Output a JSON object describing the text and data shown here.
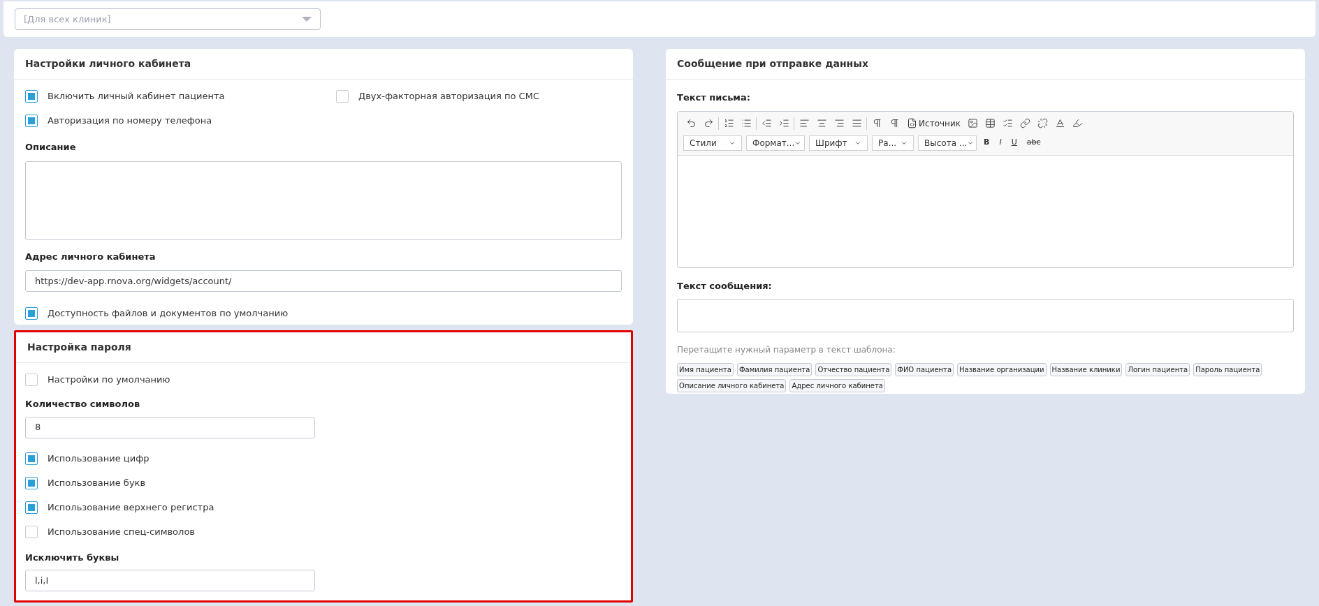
{
  "clinic_select": {
    "placeholder": "[Для всех клиник]"
  },
  "account_settings": {
    "title": "Настройки личного кабинета",
    "options": [
      {
        "label": "Включить личный кабинет пациента",
        "checked": true
      },
      {
        "label": "Двух-факторная авторизация по СМС",
        "checked": false
      },
      {
        "label": "Авторизация по номеру телефона",
        "checked": true
      }
    ],
    "description": {
      "label": "Описание"
    },
    "address": {
      "label": "Адрес личного кабинета",
      "value": "https://dev-app.rnova.org/widgets/account/"
    },
    "files_option": {
      "label": "Доступность файлов и документов по умолчанию",
      "checked": true
    }
  },
  "password_settings": {
    "title": "Настройка пароля",
    "highlighted": true,
    "default_option": {
      "label": "Настройки по умолчанию",
      "checked": false
    },
    "length": {
      "label": "Количество символов",
      "value": "8"
    },
    "options": [
      {
        "label": "Использование цифр",
        "checked": true
      },
      {
        "label": "Использование букв",
        "checked": true
      },
      {
        "label": "Использование верхнего регистра",
        "checked": true
      },
      {
        "label": "Использование спец-символов",
        "checked": false
      }
    ],
    "exclude": {
      "label": "Исключить буквы",
      "value": "l,i,I"
    }
  },
  "message_settings": {
    "title": "Сообщение при отправке данных",
    "letter_label": "Текст письма:",
    "editor": {
      "source_button": "Источник",
      "dropdowns": [
        "Стили",
        "Формат...",
        "Шрифт",
        "Ра...",
        "Высота ..."
      ],
      "format_buttons": [
        "B",
        "I",
        "U",
        "abc"
      ]
    },
    "message_label": "Текст сообщения:",
    "hint": "Перетащите нужный параметр в текст шаблона:",
    "tags": [
      "Имя пациента",
      "Фамилия пациента",
      "Отчество пациента",
      "ФИО пациента",
      "Название организации",
      "Название клиники",
      "Логин пациента",
      "Пароль пациента",
      "Описание личного кабинета",
      "Адрес личного кабинета"
    ]
  }
}
